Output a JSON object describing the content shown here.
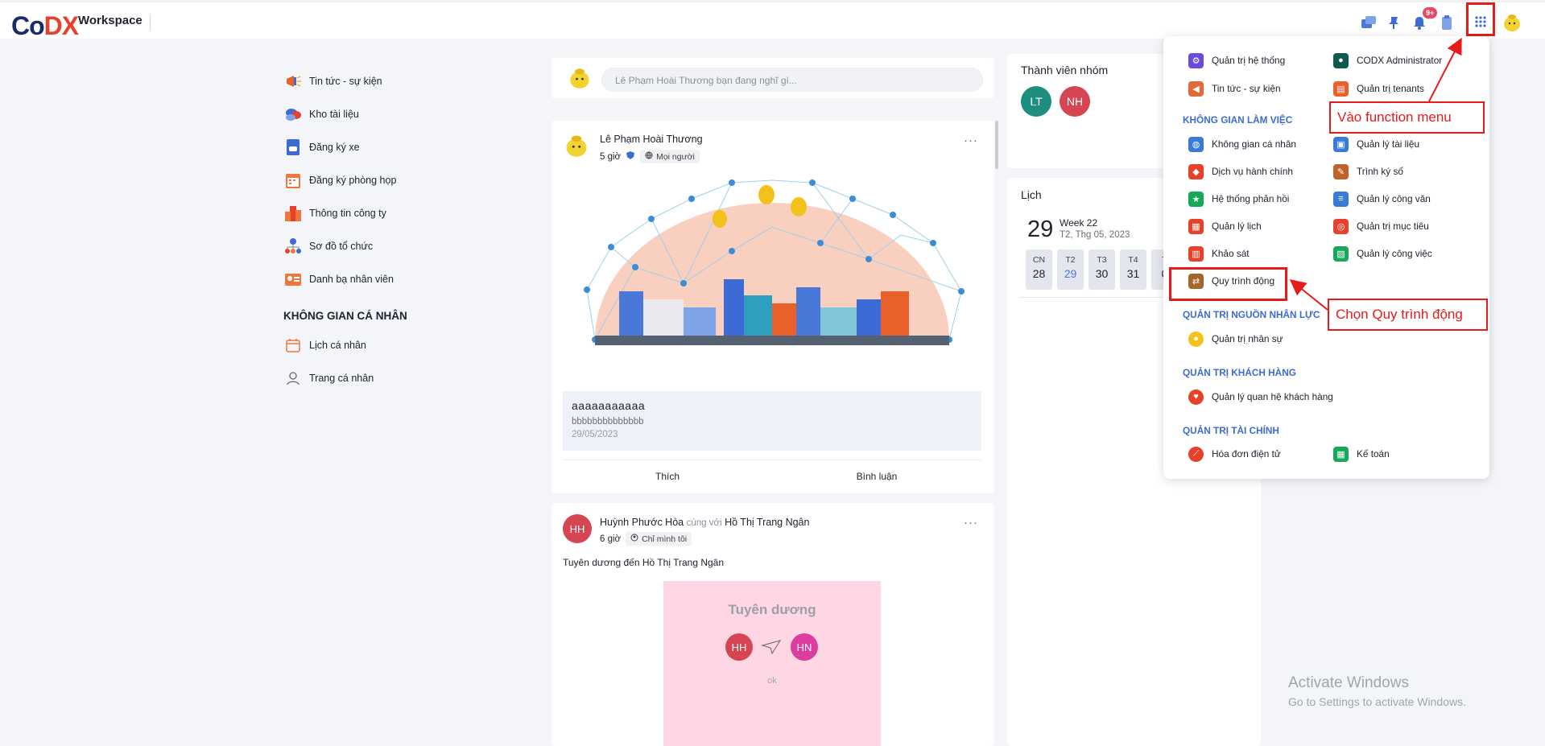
{
  "header": {
    "logo_co": "Co",
    "logo_dx": "DX",
    "title": "Workspace",
    "notif_badge": "9+"
  },
  "sidebar": {
    "items": [
      {
        "label": "Tin tức - sự kiện",
        "icon": "megaphone-icon"
      },
      {
        "label": "Kho tài liệu",
        "icon": "folder-cloud-icon"
      },
      {
        "label": "Đăng ký xe",
        "icon": "car-icon"
      },
      {
        "label": "Đăng ký phòng họp",
        "icon": "calendar-room-icon"
      },
      {
        "label": "Thông tin công ty",
        "icon": "building-icon"
      },
      {
        "label": "Sơ đồ tổ chức",
        "icon": "org-chart-icon"
      },
      {
        "label": "Danh bạ nhân viên",
        "icon": "contacts-icon"
      }
    ],
    "personal_heading": "KHÔNG GIAN CÁ NHÂN",
    "personal_items": [
      {
        "label": "Lịch cá nhân",
        "icon": "calendar-icon"
      },
      {
        "label": "Trang cá nhân",
        "icon": "user-icon"
      }
    ]
  },
  "composer": {
    "placeholder": "Lê Phạm Hoài Thương bạn đang nghĩ gì..."
  },
  "post1": {
    "author": "Lê Phạm Hoài Thương",
    "time": "5 giờ",
    "audience": "Mọi người",
    "title": "aaaaaaaaaaa",
    "body": "bbbbbbbbbbbbbb",
    "date": "29/05/2023",
    "like": "Thích",
    "comment": "Bình luận"
  },
  "post2": {
    "initials": "HH",
    "author": "Huỳnh Phước Hòa",
    "with": "cùng với",
    "tagged": "Hồ Thị Trang Ngân",
    "time": "6 giờ",
    "audience": "Chỉ mình tôi",
    "text": "Tuyên dương đến Hồ Thị Trang Ngân",
    "praise_title": "Tuyên dương",
    "praise_from": "HH",
    "praise_to": "HN",
    "praise_note": "ok"
  },
  "members": {
    "title": "Thành viên nhóm",
    "list": [
      {
        "initials": "LT",
        "color": "#1e8f7f"
      },
      {
        "initials": "NH",
        "color": "#d64552"
      }
    ]
  },
  "calendar": {
    "title": "Lịch",
    "day": "29",
    "week": "Week 22",
    "date_text": "T2, Thg 05, 2023",
    "days": [
      {
        "name": "CN",
        "num": "28"
      },
      {
        "name": "T2",
        "num": "29"
      },
      {
        "name": "T3",
        "num": "30"
      },
      {
        "name": "T4",
        "num": "31"
      },
      {
        "name": "T",
        "num": "0"
      }
    ]
  },
  "function_menu": {
    "top_items": [
      {
        "label": "Quản trị hệ thống",
        "color": "#6c4bd8"
      },
      {
        "label": "CODX Administrator",
        "color": "#0f5a4e"
      },
      {
        "label": "Tin tức - sự kiện",
        "color": "#e06a3b"
      },
      {
        "label": "Quản trị tenants",
        "color": "#e8612b"
      }
    ],
    "workspace_heading": "KHÔNG GIAN LÀM VIỆC",
    "workspace_items": [
      {
        "label": "Không gian cá nhân",
        "color": "#3a7bd5"
      },
      {
        "label": "Quản lý tài liệu",
        "color": "#3a7bd5"
      },
      {
        "label": "Dịch vụ hành chính",
        "color": "#e8412b"
      },
      {
        "label": "Trình ký số",
        "color": "#c0622b"
      },
      {
        "label": "Hệ thống phản hồi",
        "color": "#17a85a"
      },
      {
        "label": "Quản lý công văn",
        "color": "#3a7bd5"
      },
      {
        "label": "Quản lý lịch",
        "color": "#e8412b"
      },
      {
        "label": "Quản trị mục tiêu",
        "color": "#e8412b"
      },
      {
        "label": "Khảo sát",
        "color": "#e8412b"
      },
      {
        "label": "Quản lý công việc",
        "color": "#17a85a"
      },
      {
        "label": "Quy trình động",
        "color": "#a4672b"
      }
    ],
    "hr_heading": "QUẢN TRỊ NGUỒN NHÂN LỰC",
    "hr_items": [
      {
        "label": "Quản trị nhân sự",
        "color": "#f2c21b"
      }
    ],
    "crm_heading": "QUẢN TRỊ KHÁCH HÀNG",
    "crm_items": [
      {
        "label": "Quản lý quan hệ khách hàng",
        "color": "#e8412b"
      }
    ],
    "fin_heading": "QUẢN TRỊ TÀI CHÍNH",
    "fin_items": [
      {
        "label": "Hóa đơn điện tử",
        "color": "#e8412b"
      },
      {
        "label": "Kế toán",
        "color": "#17a85a"
      }
    ]
  },
  "annotations": {
    "open_menu": "Vào function menu",
    "choose": "Chọn Quy trình động"
  },
  "watermark": {
    "line1": "Activate Windows",
    "line2": "Go to Settings to activate Windows."
  }
}
